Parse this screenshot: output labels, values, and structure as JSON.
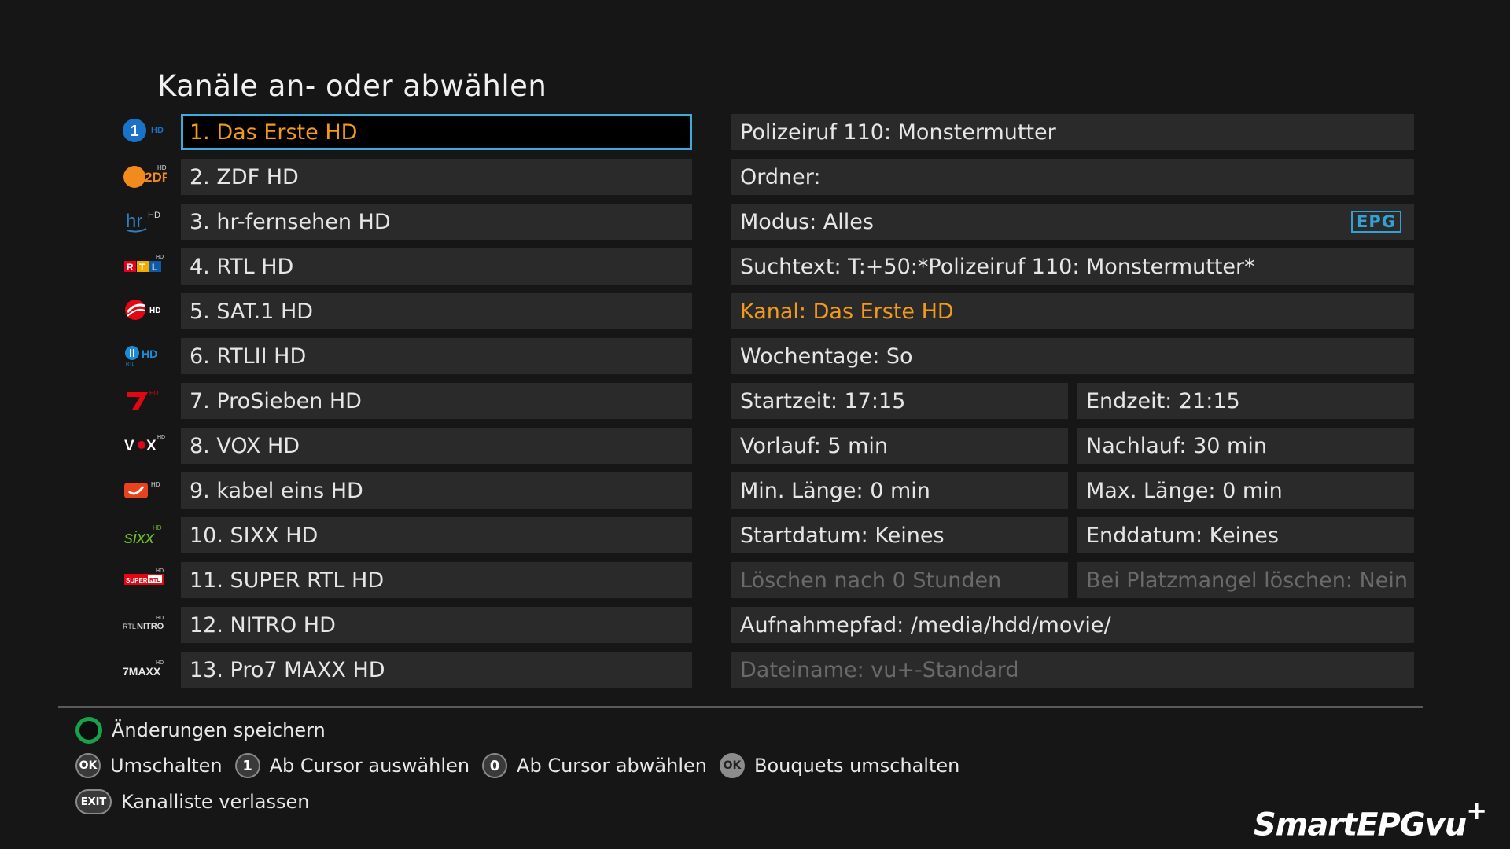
{
  "title": "Kanäle an- oder abwählen",
  "channels": [
    {
      "label": "1. Das Erste HD",
      "logo": "das-erste-logo",
      "selected": true
    },
    {
      "label": "2. ZDF HD",
      "logo": "zdf-logo"
    },
    {
      "label": "3. hr-fernsehen HD",
      "logo": "hr-logo"
    },
    {
      "label": "4. RTL HD",
      "logo": "rtl-logo"
    },
    {
      "label": "5. SAT.1 HD",
      "logo": "sat1-logo"
    },
    {
      "label": "6. RTLII HD",
      "logo": "rtl2-logo"
    },
    {
      "label": "7. ProSieben HD",
      "logo": "prosieben-logo"
    },
    {
      "label": "8. VOX HD",
      "logo": "vox-logo"
    },
    {
      "label": "9. kabel eins HD",
      "logo": "kabel-eins-logo"
    },
    {
      "label": "10. SIXX HD",
      "logo": "sixx-logo"
    },
    {
      "label": "11. SUPER RTL HD",
      "logo": "super-rtl-logo"
    },
    {
      "label": "12. NITRO HD",
      "logo": "nitro-logo"
    },
    {
      "label": "13. Pro7 MAXX HD",
      "logo": "pro7-maxx-logo"
    }
  ],
  "info": {
    "name": "Polizeiruf 110: Monstermutter",
    "folder": "Ordner:",
    "mode": "Modus: Alles",
    "mode_badge": "EPG",
    "search": "Suchtext: T:+50:*Polizeiruf 110: Monstermutter*",
    "channel": "Kanal: Das Erste HD",
    "weekdays": "Wochentage:  So",
    "start_time": "Startzeit: 17:15",
    "end_time": "Endzeit: 21:15",
    "pre": "Vorlauf: 5 min",
    "post": "Nachlauf: 30 min",
    "min_len": "Min. Länge: 0 min",
    "max_len": "Max. Länge: 0 min",
    "start_date": "Startdatum: Keines",
    "end_date": "Enddatum: Keines",
    "delete_after": "Löschen nach 0 Stunden",
    "delete_space": "Bei Platzmangel löschen: Nein",
    "path": "Aufnahmepfad: /media/hdd/movie/",
    "filename": "Dateiname: vu+-Standard"
  },
  "legend": {
    "save": "Änderungen speichern",
    "ok_key": "OK",
    "toggle": "Umschalten",
    "key_1": "1",
    "select_from_cursor": "Ab Cursor auswählen",
    "key_0": "0",
    "deselect_from_cursor": "Ab Cursor abwählen",
    "ok_key2": "OK",
    "bouquets": "Bouquets umschalten",
    "exit_key": "EXIT",
    "exit": "Kanalliste verlassen"
  },
  "brand": {
    "name": "SmartEPGvu",
    "plus": "+"
  },
  "colors": {
    "accent_orange": "#f29a1b",
    "selection_border": "#3fa9d8",
    "save_green": "#18a14b",
    "row_bg": "#2a2a2a"
  }
}
